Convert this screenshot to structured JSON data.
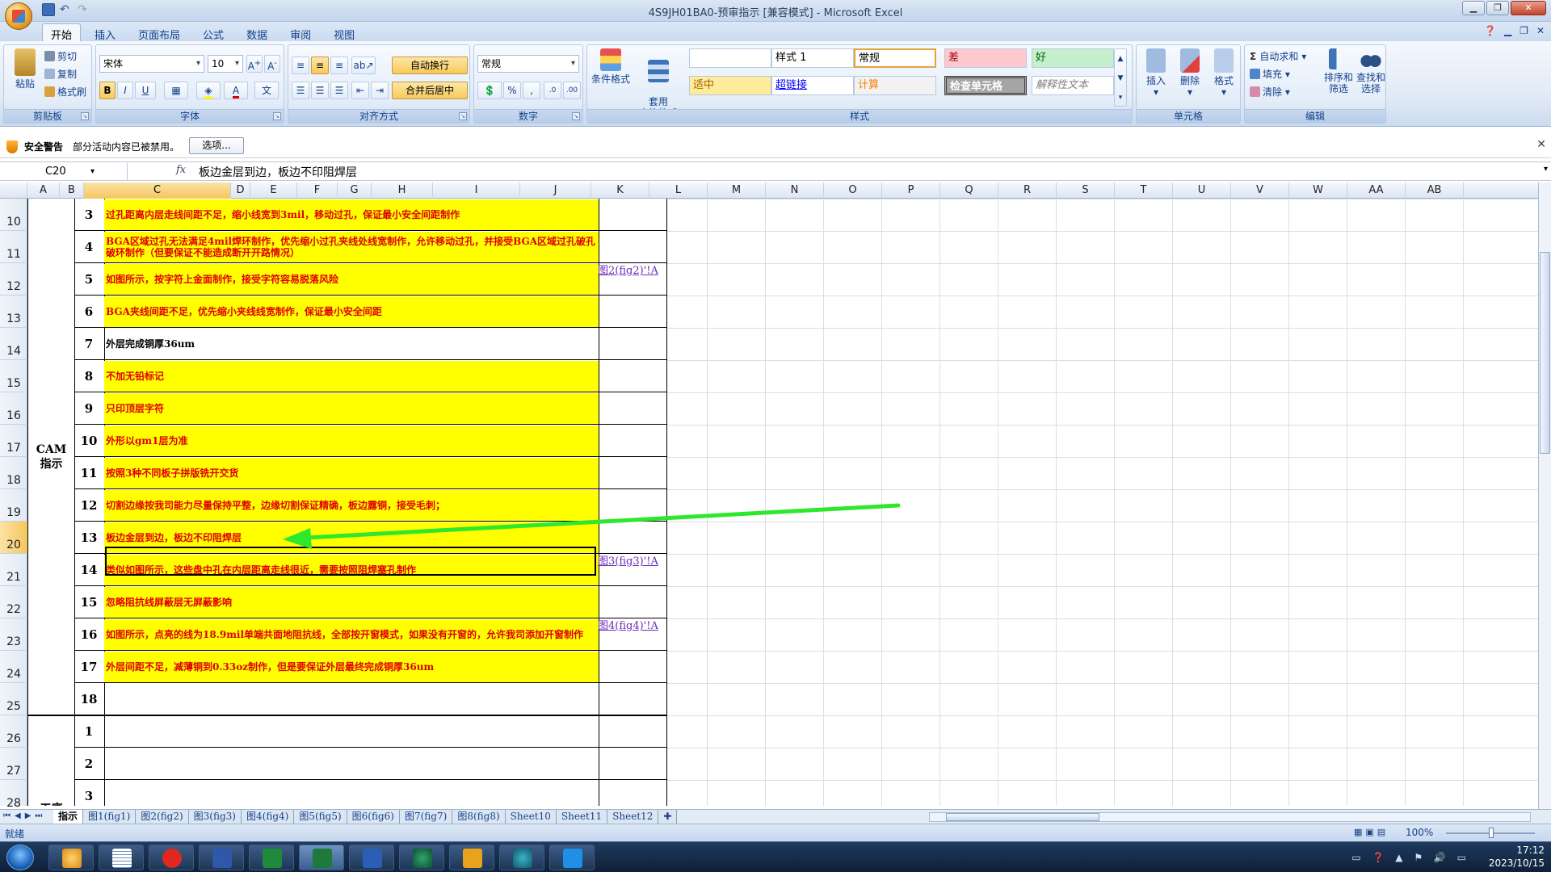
{
  "window": {
    "title": "4S9JH01BA0-预审指示 [兼容模式] - Microsoft Excel"
  },
  "ribbon": {
    "tabs": [
      "开始",
      "插入",
      "页面布局",
      "公式",
      "数据",
      "审阅",
      "视图"
    ],
    "active_tab": "开始",
    "clipboard": {
      "paste": "粘贴",
      "cut": "剪切",
      "copy": "复制",
      "format_painter": "格式刷",
      "label": "剪贴板"
    },
    "font": {
      "name": "宋体",
      "size": "10",
      "label": "字体"
    },
    "alignment": {
      "wrap": "自动换行",
      "merge": "合并后居中",
      "label": "对齐方式"
    },
    "number": {
      "format": "常规",
      "label": "数字"
    },
    "styles": {
      "conditional": "条件格式",
      "table": "套用\n表格格式",
      "label": "样式",
      "cells": [
        {
          "text": "",
          "bg": "#ffffff",
          "fg": "#000000"
        },
        {
          "text": "样式 1",
          "bg": "#ffffff",
          "fg": "#000000"
        },
        {
          "text": "常规",
          "bg": "#ffffff",
          "fg": "#000000"
        },
        {
          "text": "差",
          "bg": "#ffc7ce",
          "fg": "#9c0006"
        },
        {
          "text": "好",
          "bg": "#c6efce",
          "fg": "#006100"
        },
        {
          "text": "适中",
          "bg": "#ffeb9c",
          "fg": "#9c6500"
        },
        {
          "text": "超链接",
          "bg": "#ffffff",
          "fg": "#0000ff"
        },
        {
          "text": "计算",
          "bg": "#f2f2f2",
          "fg": "#fa7d00"
        },
        {
          "text": "检查单元格",
          "bg": "#a5a5a5",
          "fg": "#ffffff"
        },
        {
          "text": "解释性文本",
          "bg": "#ffffff",
          "fg": "#7f7f7f"
        }
      ]
    },
    "cells": {
      "insert": "插入",
      "delete": "删除",
      "format": "格式",
      "label": "单元格"
    },
    "editing": {
      "autosum": "自动求和",
      "fill": "填充",
      "clear": "清除",
      "sort": "排序和\n筛选",
      "find": "查找和\n选择",
      "label": "编辑"
    }
  },
  "security": {
    "title": "安全警告",
    "message": "部分活动内容已被禁用。",
    "options": "选项..."
  },
  "formula_bar": {
    "name_box": "C20",
    "fx": "fx",
    "content": "板边金层到边，板边不印阻焊层"
  },
  "columns": [
    "A",
    "B",
    "C",
    "D",
    "E",
    "F",
    "G",
    "H",
    "I",
    "J",
    "K",
    "L",
    "M",
    "N",
    "O",
    "P",
    "Q",
    "R",
    "S",
    "T",
    "U",
    "V",
    "W",
    "AA",
    "AB"
  ],
  "selected_column": "C",
  "selected_row": "20",
  "rows": [
    "10",
    "11",
    "12",
    "13",
    "14",
    "15",
    "16",
    "17",
    "18",
    "19",
    "20",
    "21",
    "22",
    "23",
    "24",
    "25",
    "26",
    "27",
    "28"
  ],
  "section_cam": "CAM\n指示",
  "section_process": "工序\n指示",
  "items": [
    {
      "num": "3",
      "text": "过孔距离内层走线间距不足，缩小线宽到3mil，移动过孔，保证最小安全间距制作",
      "link": "",
      "yellow": true
    },
    {
      "num": "4",
      "text": "BGA区域过孔无法满足4mil焊环制作，优先缩小过孔夹线处线宽制作，允许移动过孔，并接受BGA区域过孔破孔破环制作（但要保证不能造成断开开路情况）",
      "link": "",
      "yellow": true
    },
    {
      "num": "5",
      "text": "如图所示，按字符上金面制作，接受字符容易脱落风险",
      "link": "图2(fig2)'!A",
      "yellow": true
    },
    {
      "num": "6",
      "text": "BGA夹线间距不足，优先缩小夹线线宽制作，保证最小安全间距",
      "link": "",
      "yellow": true
    },
    {
      "num": "7",
      "text": "外层完成铜厚36um",
      "link": "",
      "yellow": false
    },
    {
      "num": "8",
      "text": "不加无铅标记",
      "link": "",
      "yellow": true
    },
    {
      "num": "9",
      "text": "只印顶层字符",
      "link": "",
      "yellow": true
    },
    {
      "num": "10",
      "text": "外形以gm1层为准",
      "link": "",
      "yellow": true
    },
    {
      "num": "11",
      "text": "按照3种不同板子拼版铣开交货",
      "link": "",
      "yellow": true
    },
    {
      "num": "12",
      "text": "切割边缘按我司能力尽量保持平整，边缘切割保证精确，板边露铜，接受毛刺；",
      "link": "",
      "yellow": true
    },
    {
      "num": "13",
      "text": "板边金层到边，板边不印阻焊层",
      "link": "",
      "yellow": true
    },
    {
      "num": "14",
      "text": "类似如图所示，这些盘中孔在内层距离走线很近，需要按照阻焊塞孔制作",
      "link": "图3(fig3)'!A",
      "yellow": true
    },
    {
      "num": "15",
      "text": "忽略阻抗线屏蔽层无屏蔽影响",
      "link": "",
      "yellow": true
    },
    {
      "num": "16",
      "text": "如图所示，点亮的线为18.9mil单端共面地阻抗线，全部按开窗模式，如果没有开窗的，允许我司添加开窗制作",
      "link": "图4(fig4)'!A",
      "yellow": true
    },
    {
      "num": "17",
      "text": "外层间距不足，减薄铜到0.33oz制作，但是要保证外层最终完成铜厚36um",
      "link": "",
      "yellow": true
    },
    {
      "num": "18",
      "text": "",
      "link": "",
      "yellow": false
    }
  ],
  "process_items": [
    {
      "num": "1"
    },
    {
      "num": "2"
    },
    {
      "num": "3"
    }
  ],
  "sheet_tabs": [
    "指示",
    "图1(fig1)",
    "图2(fig2)",
    "图3(fig3)",
    "图4(fig4)",
    "图5(fig5)",
    "图6(fig6)",
    "图7(fig7)",
    "图8(fig8)",
    "Sheet10",
    "Sheet11",
    "Sheet12"
  ],
  "active_sheet": "指示",
  "status": {
    "ready": "就绪",
    "zoom": "100%"
  },
  "taskbar": {
    "time": "17:12",
    "date": "2023/10/15"
  }
}
